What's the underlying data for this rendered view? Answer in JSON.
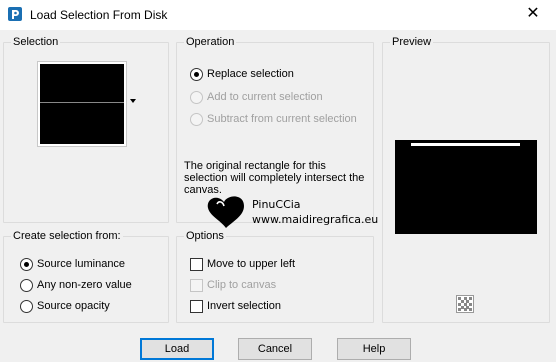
{
  "window": {
    "title": "Load Selection From Disk",
    "close_glyph": "✕",
    "app_icon": "paintshop-pro-icon"
  },
  "selection_group": {
    "label": "Selection",
    "dropdown_icon": "dropdown-arrow-icon"
  },
  "operation_group": {
    "label": "Operation",
    "options": [
      {
        "label": "Replace selection",
        "checked": true,
        "enabled": true
      },
      {
        "label": "Add to current selection",
        "checked": false,
        "enabled": false
      },
      {
        "label": "Subtract from current selection",
        "checked": false,
        "enabled": false
      }
    ],
    "info_text": "The original rectangle for this selection will completely intersect the canvas."
  },
  "preview_group": {
    "label": "Preview",
    "zoom_icon": "preview-zoom-icon"
  },
  "create_group": {
    "label": "Create selection from:",
    "options": [
      {
        "label": "Source luminance",
        "checked": true
      },
      {
        "label": "Any non-zero value",
        "checked": false
      },
      {
        "label": "Source opacity",
        "checked": false
      }
    ]
  },
  "options_group": {
    "label": "Options",
    "items": [
      {
        "label": "Move to upper left",
        "checked": false,
        "enabled": true
      },
      {
        "label": "Clip to canvas",
        "checked": false,
        "enabled": false
      },
      {
        "label": "Invert selection",
        "checked": false,
        "enabled": true
      }
    ]
  },
  "watermark": {
    "name": "PinuCCia",
    "site": "www.maidiregrafica.eu"
  },
  "buttons": {
    "load": "Load",
    "cancel": "Cancel",
    "help": "Help"
  },
  "colors": {
    "background": "#f0f0f0",
    "accent": "#0078d7",
    "thumbnail": "#000000"
  }
}
